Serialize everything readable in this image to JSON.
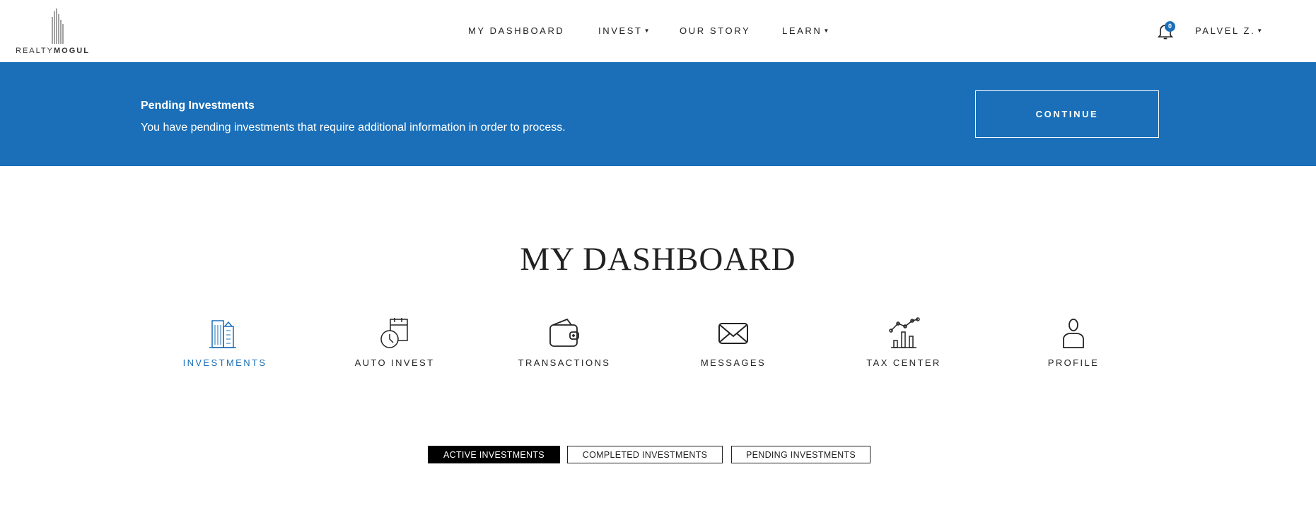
{
  "brand": {
    "logo_text_light": "REALTY",
    "logo_text_bold": "MOGUL"
  },
  "nav": {
    "items": [
      {
        "label": "MY DASHBOARD",
        "dropdown": false
      },
      {
        "label": "INVEST",
        "dropdown": true
      },
      {
        "label": "OUR STORY",
        "dropdown": false
      },
      {
        "label": "LEARN",
        "dropdown": true
      }
    ]
  },
  "notifications": {
    "count": "0",
    "icon": "bell-icon"
  },
  "user": {
    "name": "PALVEL Z."
  },
  "banner": {
    "title": "Pending Investments",
    "text": "You have pending investments that require additional information in order to process.",
    "button": "CONTINUE",
    "color": "#1a6fb8"
  },
  "page": {
    "title": "MY DASHBOARD"
  },
  "tiles": [
    {
      "label": "INVESTMENTS",
      "icon": "buildings-icon",
      "active": true
    },
    {
      "label": "AUTO INVEST",
      "icon": "calendar-clock-icon",
      "active": false
    },
    {
      "label": "TRANSACTIONS",
      "icon": "wallet-icon",
      "active": false
    },
    {
      "label": "MESSAGES",
      "icon": "envelope-icon",
      "active": false
    },
    {
      "label": "TAX CENTER",
      "icon": "chart-icon",
      "active": false
    },
    {
      "label": "PROFILE",
      "icon": "user-icon",
      "active": false
    }
  ],
  "tabs": [
    {
      "label": "ACTIVE INVESTMENTS",
      "selected": true
    },
    {
      "label": "COMPLETED INVESTMENTS",
      "selected": false
    },
    {
      "label": "PENDING INVESTMENTS",
      "selected": false
    }
  ]
}
